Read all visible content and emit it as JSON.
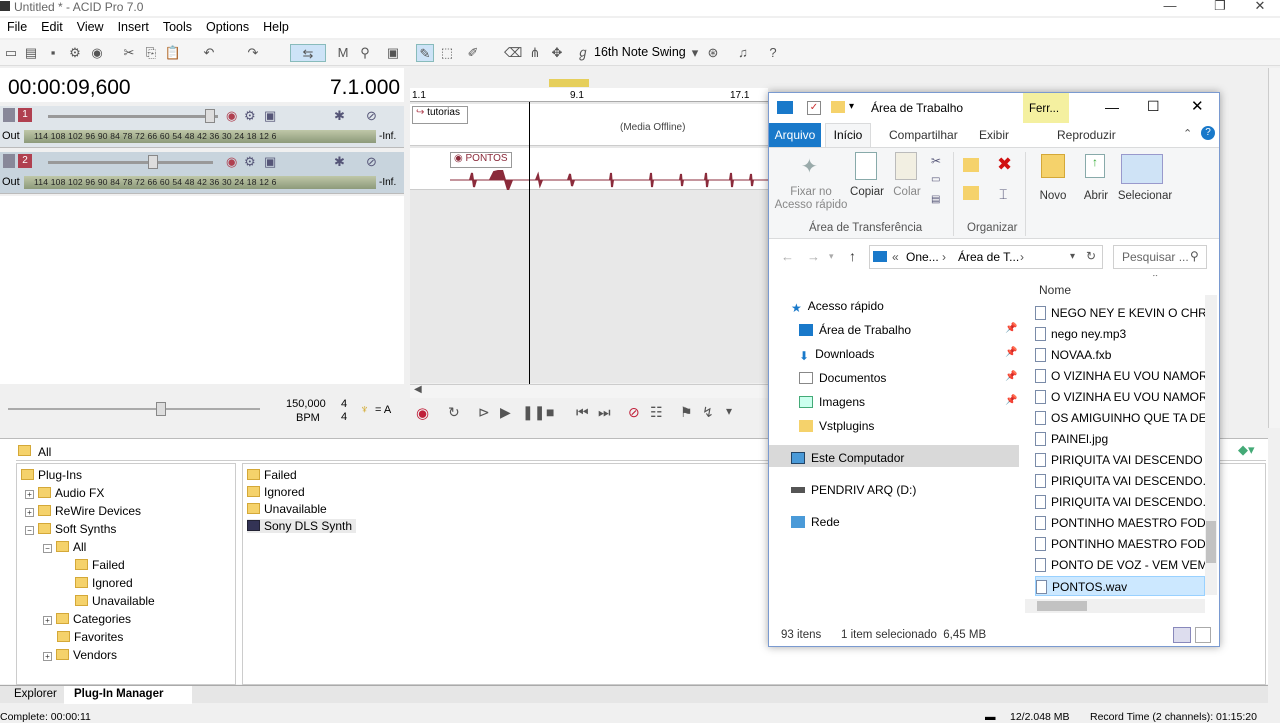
{
  "app": {
    "title": "Untitled * - ACID Pro 7.0"
  },
  "menu": [
    "File",
    "Edit",
    "View",
    "Insert",
    "Tools",
    "Options",
    "Help"
  ],
  "toolbar": {
    "swing_label": "16th Note Swing"
  },
  "transport": {
    "time": "00:00:09,600",
    "measure": "7.1.000",
    "bpm_value": "150,000",
    "bpm_label": "BPM",
    "sig_top": "4",
    "sig_bottom": "4",
    "key": "= A"
  },
  "tracks": [
    {
      "num": "1",
      "out": "Out",
      "inf": "-Inf.",
      "meter_scale": "114 108 102 96 90 84 78 72 66 60 54 48 42 36 30 24 18 12 6",
      "clip": "tutorias",
      "clip_status": "(Media Offline)"
    },
    {
      "num": "2",
      "out": "Out",
      "inf": "-Inf.",
      "meter_scale": "114 108 102 96 90 84 78 72 66 60 54 48 42 36 30 24 18 12 6",
      "clip": "PONTOS"
    }
  ],
  "ruler": [
    "1.1",
    "9.1",
    "17.1"
  ],
  "plugin_panel": {
    "path": "All",
    "tree": [
      "Plug-Ins",
      "Audio FX",
      "ReWire Devices",
      "Soft Synths",
      "All",
      "Failed",
      "Ignored",
      "Unavailable",
      "Categories",
      "Favorites",
      "Vendors"
    ],
    "list": [
      "Failed",
      "Ignored",
      "Unavailable",
      "Sony DLS Synth"
    ]
  },
  "tabs": {
    "explorer": "Explorer",
    "plugin_manager": "Plug-In Manager"
  },
  "status": {
    "left": "Complete: 00:00:11",
    "mem": "12/2.048 MB",
    "record": "Record Time (2 channels): 01:15:20"
  },
  "explorer": {
    "title": "Área de Trabalho",
    "ferr_tab": "Ferr...",
    "ribbon_tabs": {
      "arquivo": "Arquivo",
      "inicio": "Início",
      "compartilhar": "Compartilhar",
      "exibir": "Exibir",
      "reproduzir": "Reproduzir"
    },
    "ribbon": {
      "fixar": "Fixar no Acesso rápido",
      "copiar": "Copiar",
      "colar": "Colar",
      "group_clipboard": "Área de Transferência",
      "group_organize": "Organizar",
      "novo": "Novo",
      "abrir": "Abrir",
      "selecionar": "Selecionar"
    },
    "address": {
      "part1": "One...",
      "part2": "Área de T...",
      "search_placeholder": "Pesquisar ..."
    },
    "nav": [
      {
        "label": "Acesso rápido"
      },
      {
        "label": "Área de Trabalho"
      },
      {
        "label": "Downloads"
      },
      {
        "label": "Documentos"
      },
      {
        "label": "Imagens"
      },
      {
        "label": "Vstplugins"
      },
      {
        "label": "Este Computador"
      },
      {
        "label": "PENDRIV ARQ (D:)"
      },
      {
        "label": "Rede"
      }
    ],
    "column_name": "Nome",
    "files": [
      "NEGO NEY E KEVIN O CHRIS",
      "nego ney.mp3",
      "NOVAA.fxb",
      "O VIZINHA EU VOU NAMORA",
      "O VIZINHA EU VOU NAMORA",
      "OS AMIGUINHO QUE TA DE F",
      "PAINEl.jpg",
      "PIRIQUITA VAI DESCENDO vs",
      "PIRIQUITA VAI DESCENDO.mp",
      "PIRIQUITA VAI DESCENDO.mp",
      "PONTINHO MAESTRO FODA",
      "PONTINHO MAESTRO FODA",
      "PONTO DE VOZ - VEM VEM",
      "PONTOS.wav"
    ],
    "status_count": "93 itens",
    "status_selected": "1 item selecionado  6,45 MB"
  }
}
